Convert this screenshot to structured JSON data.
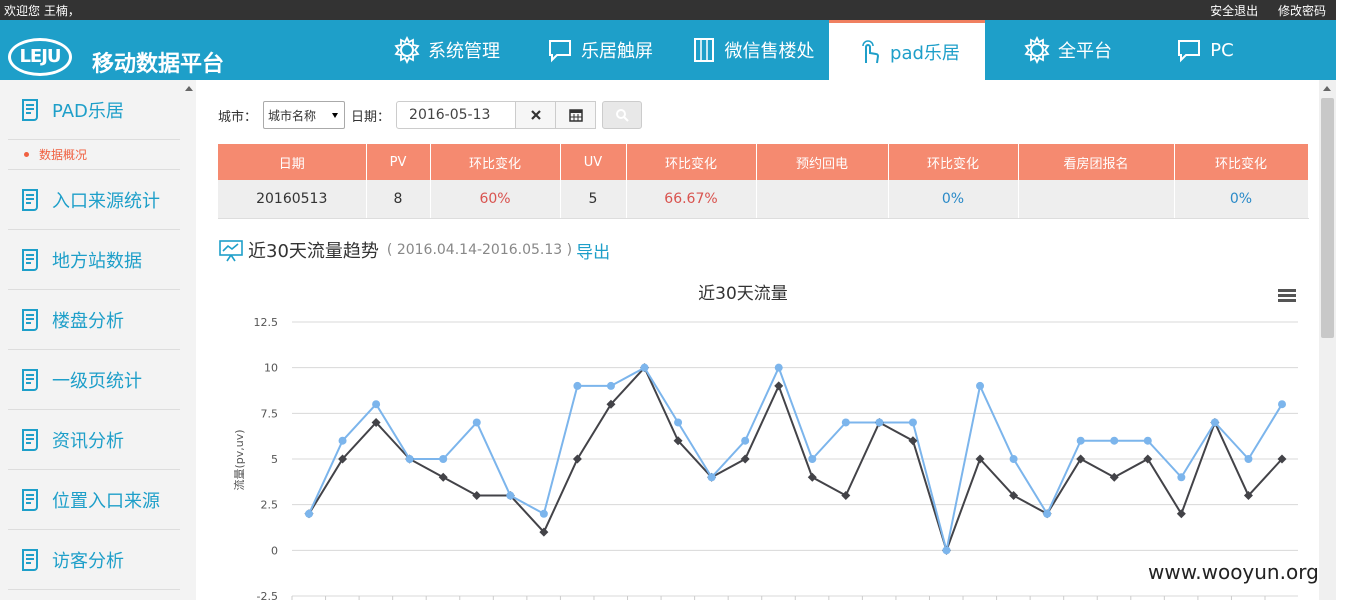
{
  "topbar": {
    "welcome": "欢迎您 王楠，",
    "logout": "安全退出",
    "change_password": "修改密码"
  },
  "header": {
    "logo_text": "LEJU",
    "platform_title": "移动数据平台",
    "nav": [
      {
        "label": "系统管理",
        "icon": "gear-icon"
      },
      {
        "label": "乐居触屏",
        "icon": "chat-icon"
      },
      {
        "label": "微信售楼处",
        "icon": "building-icon"
      },
      {
        "label": "pad乐居",
        "icon": "touch-icon",
        "active": true
      },
      {
        "label": "全平台",
        "icon": "gear-icon"
      },
      {
        "label": "PC",
        "icon": "chat-icon"
      }
    ]
  },
  "sidebar": {
    "items": [
      "PAD乐居",
      "入口来源统计",
      "地方站数据",
      "楼盘分析",
      "一级页统计",
      "资讯分析",
      "位置入口来源",
      "访客分析"
    ],
    "sub_item": "数据概况"
  },
  "filter": {
    "city_label": "城市：",
    "city_value": "城市名称",
    "date_label": "日期：",
    "date_value": "2016-05-13"
  },
  "stats": {
    "headers": [
      "日期",
      "PV",
      "环比变化",
      "UV",
      "环比变化",
      "预约回电",
      "环比变化",
      "看房团报名",
      "环比变化"
    ],
    "row": [
      "20160513",
      "8",
      "60%",
      "5",
      "66.67%",
      "",
      "0%",
      "",
      "0%"
    ]
  },
  "trend": {
    "title": "近30天流量趋势",
    "range": "( 2016.04.14-2016.05.13 )",
    "export": "导出"
  },
  "chart_data": {
    "type": "line",
    "title": "近30天流量",
    "ylabel": "流量(pv,uv)",
    "ylim": [
      -2.5,
      12.5
    ],
    "yticks": [
      "12.5",
      "10",
      "7.5",
      "5",
      "2.5",
      "0",
      "-2.5"
    ],
    "grid": true,
    "series": [
      {
        "color": "#7cb5ec",
        "values": [
          2,
          6,
          8,
          5,
          5,
          7,
          3,
          2,
          9,
          9,
          10,
          7,
          4,
          6,
          10,
          5,
          7,
          7,
          7,
          0,
          9,
          5,
          2,
          6,
          6,
          6,
          4,
          7,
          5,
          8
        ]
      },
      {
        "color": "#434348",
        "values": [
          2,
          5,
          7,
          5,
          4,
          3,
          3,
          1,
          5,
          8,
          10,
          6,
          4,
          5,
          9,
          4,
          3,
          7,
          6,
          0,
          5,
          3,
          2,
          5,
          4,
          5,
          2,
          7,
          3,
          5
        ]
      }
    ]
  },
  "watermark": "www.wooyun.org"
}
